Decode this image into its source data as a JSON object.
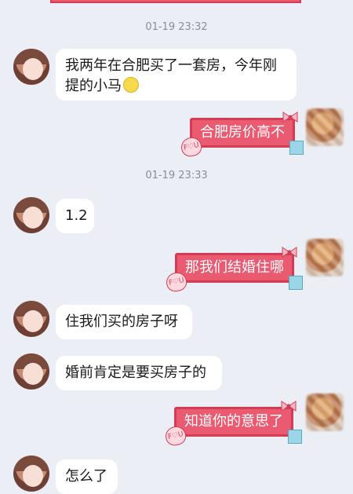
{
  "colors": {
    "background": "#eceef6",
    "left_bubble": "#ffffff",
    "right_bubble": "#ea5a70",
    "right_bubble_border": "#d43c55",
    "timestamp_text": "#8a8d99"
  },
  "timestamps": [
    "01-19 23:32",
    "01-19 23:33"
  ],
  "messages": [
    {
      "side": "left",
      "text_line1": "我两年在合肥买了一套房，今年刚",
      "text_line2": "提的小马",
      "has_emoji": true
    },
    {
      "side": "right",
      "text": "合肥房价高不"
    },
    {
      "side": "left",
      "text": "1.2"
    },
    {
      "side": "right",
      "text": "那我们结婚住哪"
    },
    {
      "side": "left",
      "text": "住我们买的房子呀"
    },
    {
      "side": "left",
      "text": "婚前肯定是要买房子的"
    },
    {
      "side": "right",
      "text": "知道你的意思了"
    },
    {
      "side": "left",
      "text": "怎么了"
    }
  ],
  "bubble_decoration": {
    "heart_text": "F♡U",
    "icons": [
      "bow-icon",
      "heart-icon",
      "gift-box-icon"
    ]
  },
  "avatars": {
    "other": "girl-avatar-icon",
    "self": "blurred-avatar-icon"
  }
}
